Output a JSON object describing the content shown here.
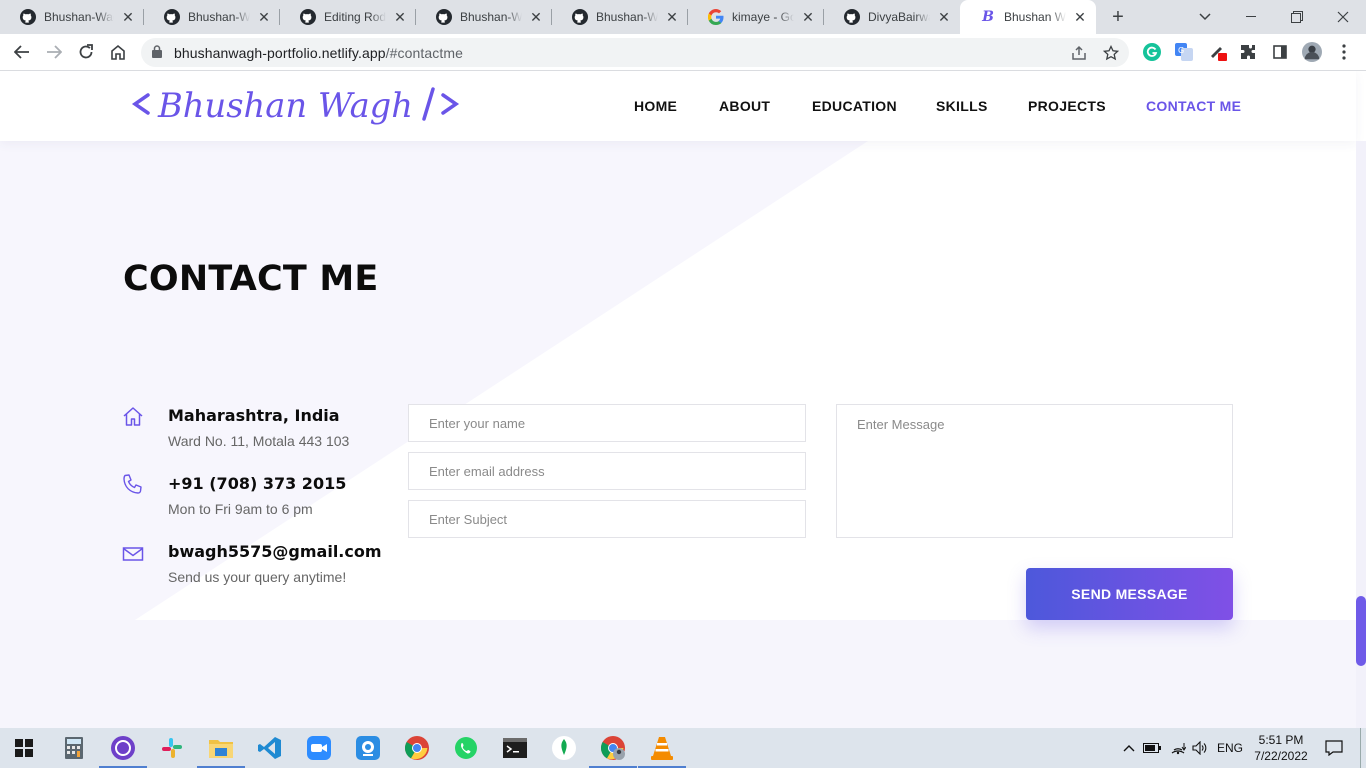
{
  "browser": {
    "tabs": [
      {
        "title": "Bhushan-Wagh",
        "icon": "github-icon"
      },
      {
        "title": "Bhushan-Wagh",
        "icon": "github-icon"
      },
      {
        "title": "Editing Rodan",
        "icon": "github-icon"
      },
      {
        "title": "Bhushan-Wagh",
        "icon": "github-icon"
      },
      {
        "title": "Bhushan-Wagh",
        "icon": "github-icon"
      },
      {
        "title": "kimaye - Google",
        "icon": "google-icon"
      },
      {
        "title": "DivyaBairwa (",
        "icon": "github-icon"
      },
      {
        "title": "Bhushan Wagh",
        "icon": "portfolio-icon",
        "active": true
      }
    ],
    "url_host": "bhushanwagh-portfolio.netlify.app",
    "url_rest": "/#contactme"
  },
  "site": {
    "logo_text": "< Bhushan Wagh />",
    "nav": [
      "HOME",
      "ABOUT",
      "EDUCATION",
      "SKILLS",
      "PROJECTS",
      "CONTACT ME"
    ],
    "active_nav": "CONTACT ME",
    "accent_color": "#6a55e8",
    "heading": "CONTACT ME",
    "contact": [
      {
        "icon": "home-icon",
        "title": "Maharashtra, India",
        "subtitle": "Ward No. 11, Motala 443 103"
      },
      {
        "icon": "phone-icon",
        "title": "+91 (708) 373 2015",
        "subtitle": "Mon to Fri 9am to 6 pm"
      },
      {
        "icon": "mail-icon",
        "title": "bwagh5575@gmail.com",
        "subtitle": "Send us your query anytime!"
      }
    ],
    "form": {
      "name_placeholder": "Enter your name",
      "email_placeholder": "Enter email address",
      "subject_placeholder": "Enter Subject",
      "message_placeholder": "Enter Message",
      "submit_label": "SEND MESSAGE"
    }
  },
  "taskbar": {
    "language": "ENG",
    "time": "5:51 PM",
    "date": "7/22/2022"
  }
}
